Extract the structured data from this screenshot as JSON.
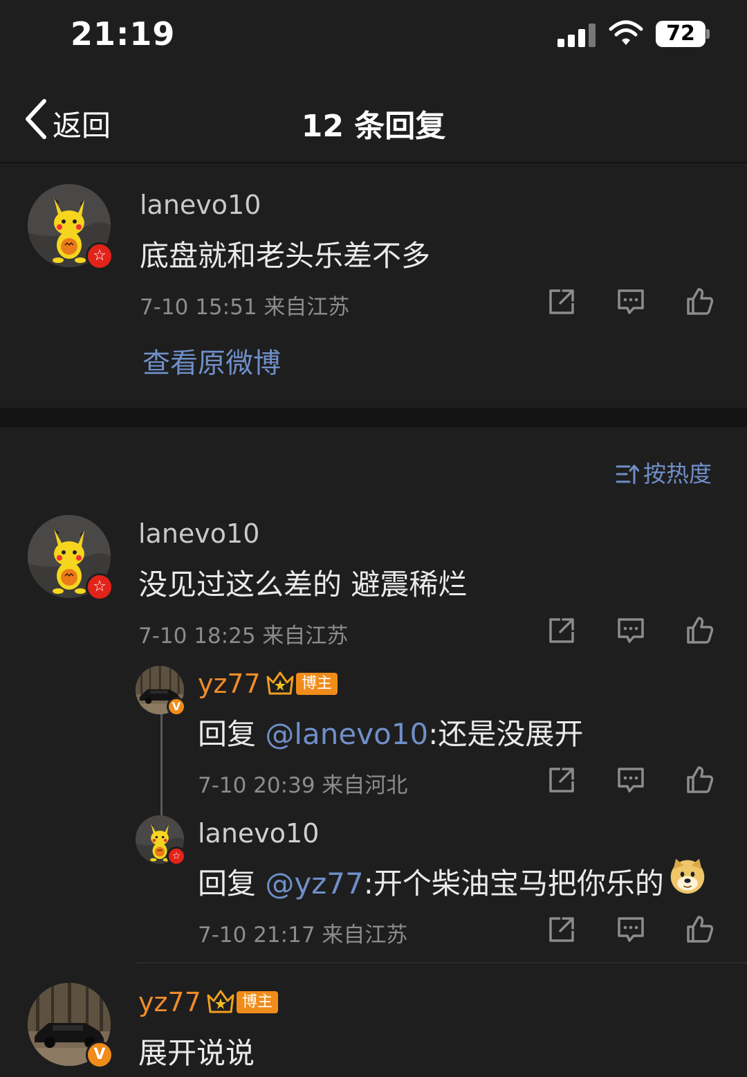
{
  "status_bar": {
    "time": "21:19",
    "battery": "72"
  },
  "nav": {
    "back_label": "返回",
    "title": "12 条回复"
  },
  "root_comment": {
    "username": "lanevo10",
    "text": "底盘就和老头乐差不多",
    "meta": "7-10 15:51  来自江苏",
    "view_original": "查看原微博"
  },
  "sort_label": "按热度",
  "comment": {
    "username": "lanevo10",
    "text": "没见过这么差的 避震稀烂",
    "meta": "7-10 18:25  来自江苏",
    "replies": [
      {
        "username": "yz77",
        "tag": "博主",
        "reply_prefix": "回复 ",
        "mention": "@lanevo10",
        "text": ":还是没展开",
        "meta": "7-10 20:39  来自河北"
      },
      {
        "username": "lanevo10",
        "reply_prefix": "回复 ",
        "mention": "@yz77",
        "text": ":开个柴油宝马把你乐的",
        "meta": "7-10 21:17  来自江苏"
      }
    ]
  },
  "next_comment": {
    "username": "yz77",
    "tag": "博主",
    "text": "展开说说"
  },
  "icons": [
    "share-icon",
    "comment-icon",
    "like-icon"
  ],
  "colors": {
    "background": "#1e1e1e",
    "link": "#6f8fc8",
    "accent_orange": "#f08c1a",
    "badge_red": "#e2231a"
  }
}
